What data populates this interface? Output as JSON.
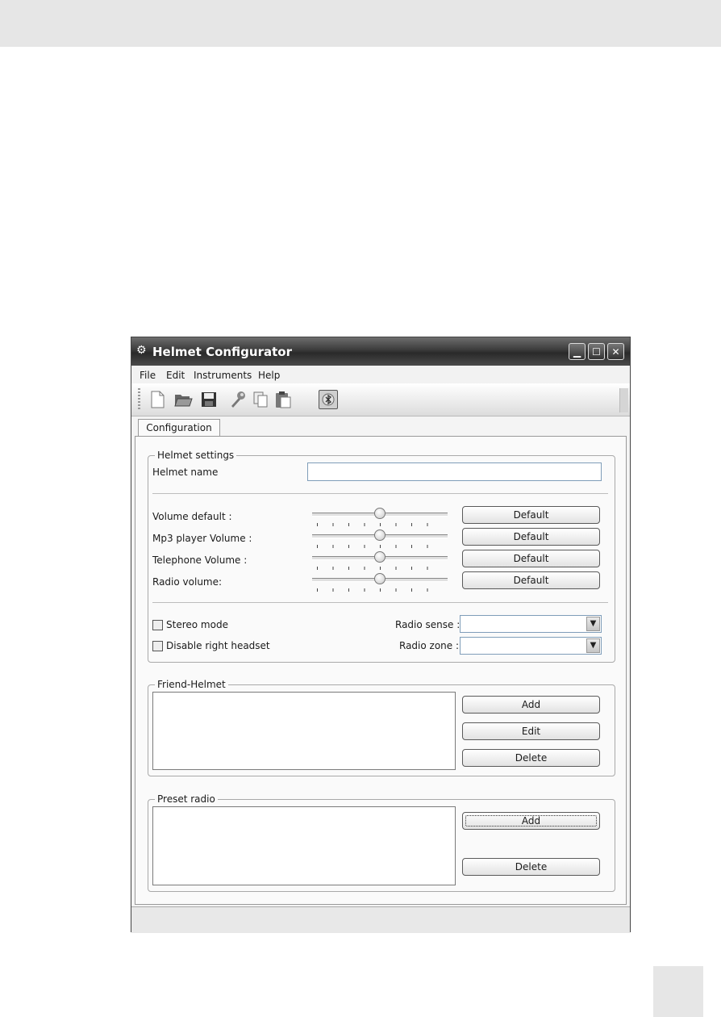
{
  "window": {
    "title": "Helmet Configurator"
  },
  "menu": {
    "file": "File",
    "edit": "Edit",
    "instruments": "Instruments",
    "help": "Help"
  },
  "toolbar": {
    "icons": [
      "new-file-icon",
      "open-folder-icon",
      "save-icon",
      "wrench-icon",
      "copy-icon",
      "paste-icon",
      "bluetooth-icon"
    ],
    "pressed": "bluetooth-icon"
  },
  "tabs": [
    {
      "label": "Configuration",
      "selected": true
    }
  ],
  "helmet_settings": {
    "legend": "Helmet settings",
    "name_label": "Helmet name",
    "name_value": "",
    "sliders": [
      {
        "label": "Volume default :",
        "level": 0.5,
        "button": "Default"
      },
      {
        "label": "Mp3 player Volume :",
        "level": 0.5,
        "button": "Default"
      },
      {
        "label": "Telephone Volume :",
        "level": 0.5,
        "button": "Default"
      },
      {
        "label": "Radio volume:",
        "level": 0.5,
        "button": "Default"
      }
    ],
    "stereo_mode": {
      "label": "Stereo mode",
      "checked": false
    },
    "disable_right": {
      "label": "Disable right headset",
      "checked": false
    },
    "radio_sense": {
      "label": "Radio sense :",
      "value": ""
    },
    "radio_zone": {
      "label": "Radio zone :",
      "value": ""
    }
  },
  "friend_helmet": {
    "legend": "Friend-Helmet",
    "add": "Add",
    "edit": "Edit",
    "delete": "Delete"
  },
  "preset_radio": {
    "legend": "Preset radio",
    "add": "Add",
    "delete": "Delete"
  }
}
